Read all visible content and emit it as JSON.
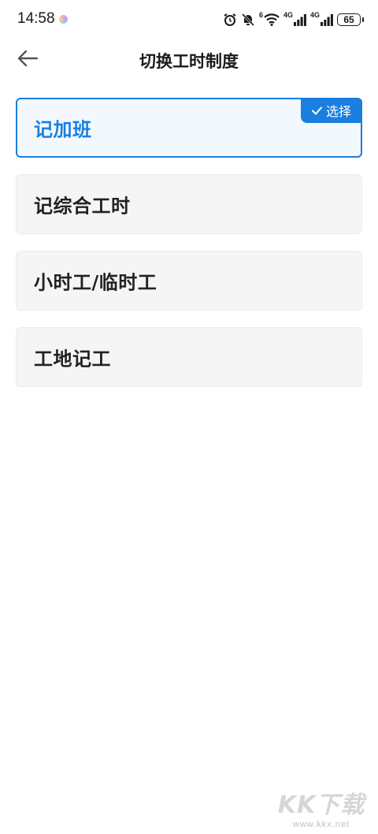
{
  "status_bar": {
    "time": "14:58",
    "network_labels": [
      "6",
      "4G",
      "4G"
    ],
    "battery": "65"
  },
  "header": {
    "title": "切换工时制度",
    "back_icon": "arrow-left-icon"
  },
  "options": [
    {
      "label": "记加班",
      "selected": true
    },
    {
      "label": "记综合工时",
      "selected": false
    },
    {
      "label": "小时工/临时工",
      "selected": false
    },
    {
      "label": "工地记工",
      "selected": false
    }
  ],
  "selected_badge": {
    "label": "选择",
    "icon": "check-icon"
  },
  "watermark": {
    "logo": "KK下载",
    "url": "www.kkx.net"
  },
  "colors": {
    "accent": "#1a7fe0",
    "card_bg": "#f5f5f5",
    "selected_bg": "#f3f8fe",
    "text": "#222222"
  }
}
